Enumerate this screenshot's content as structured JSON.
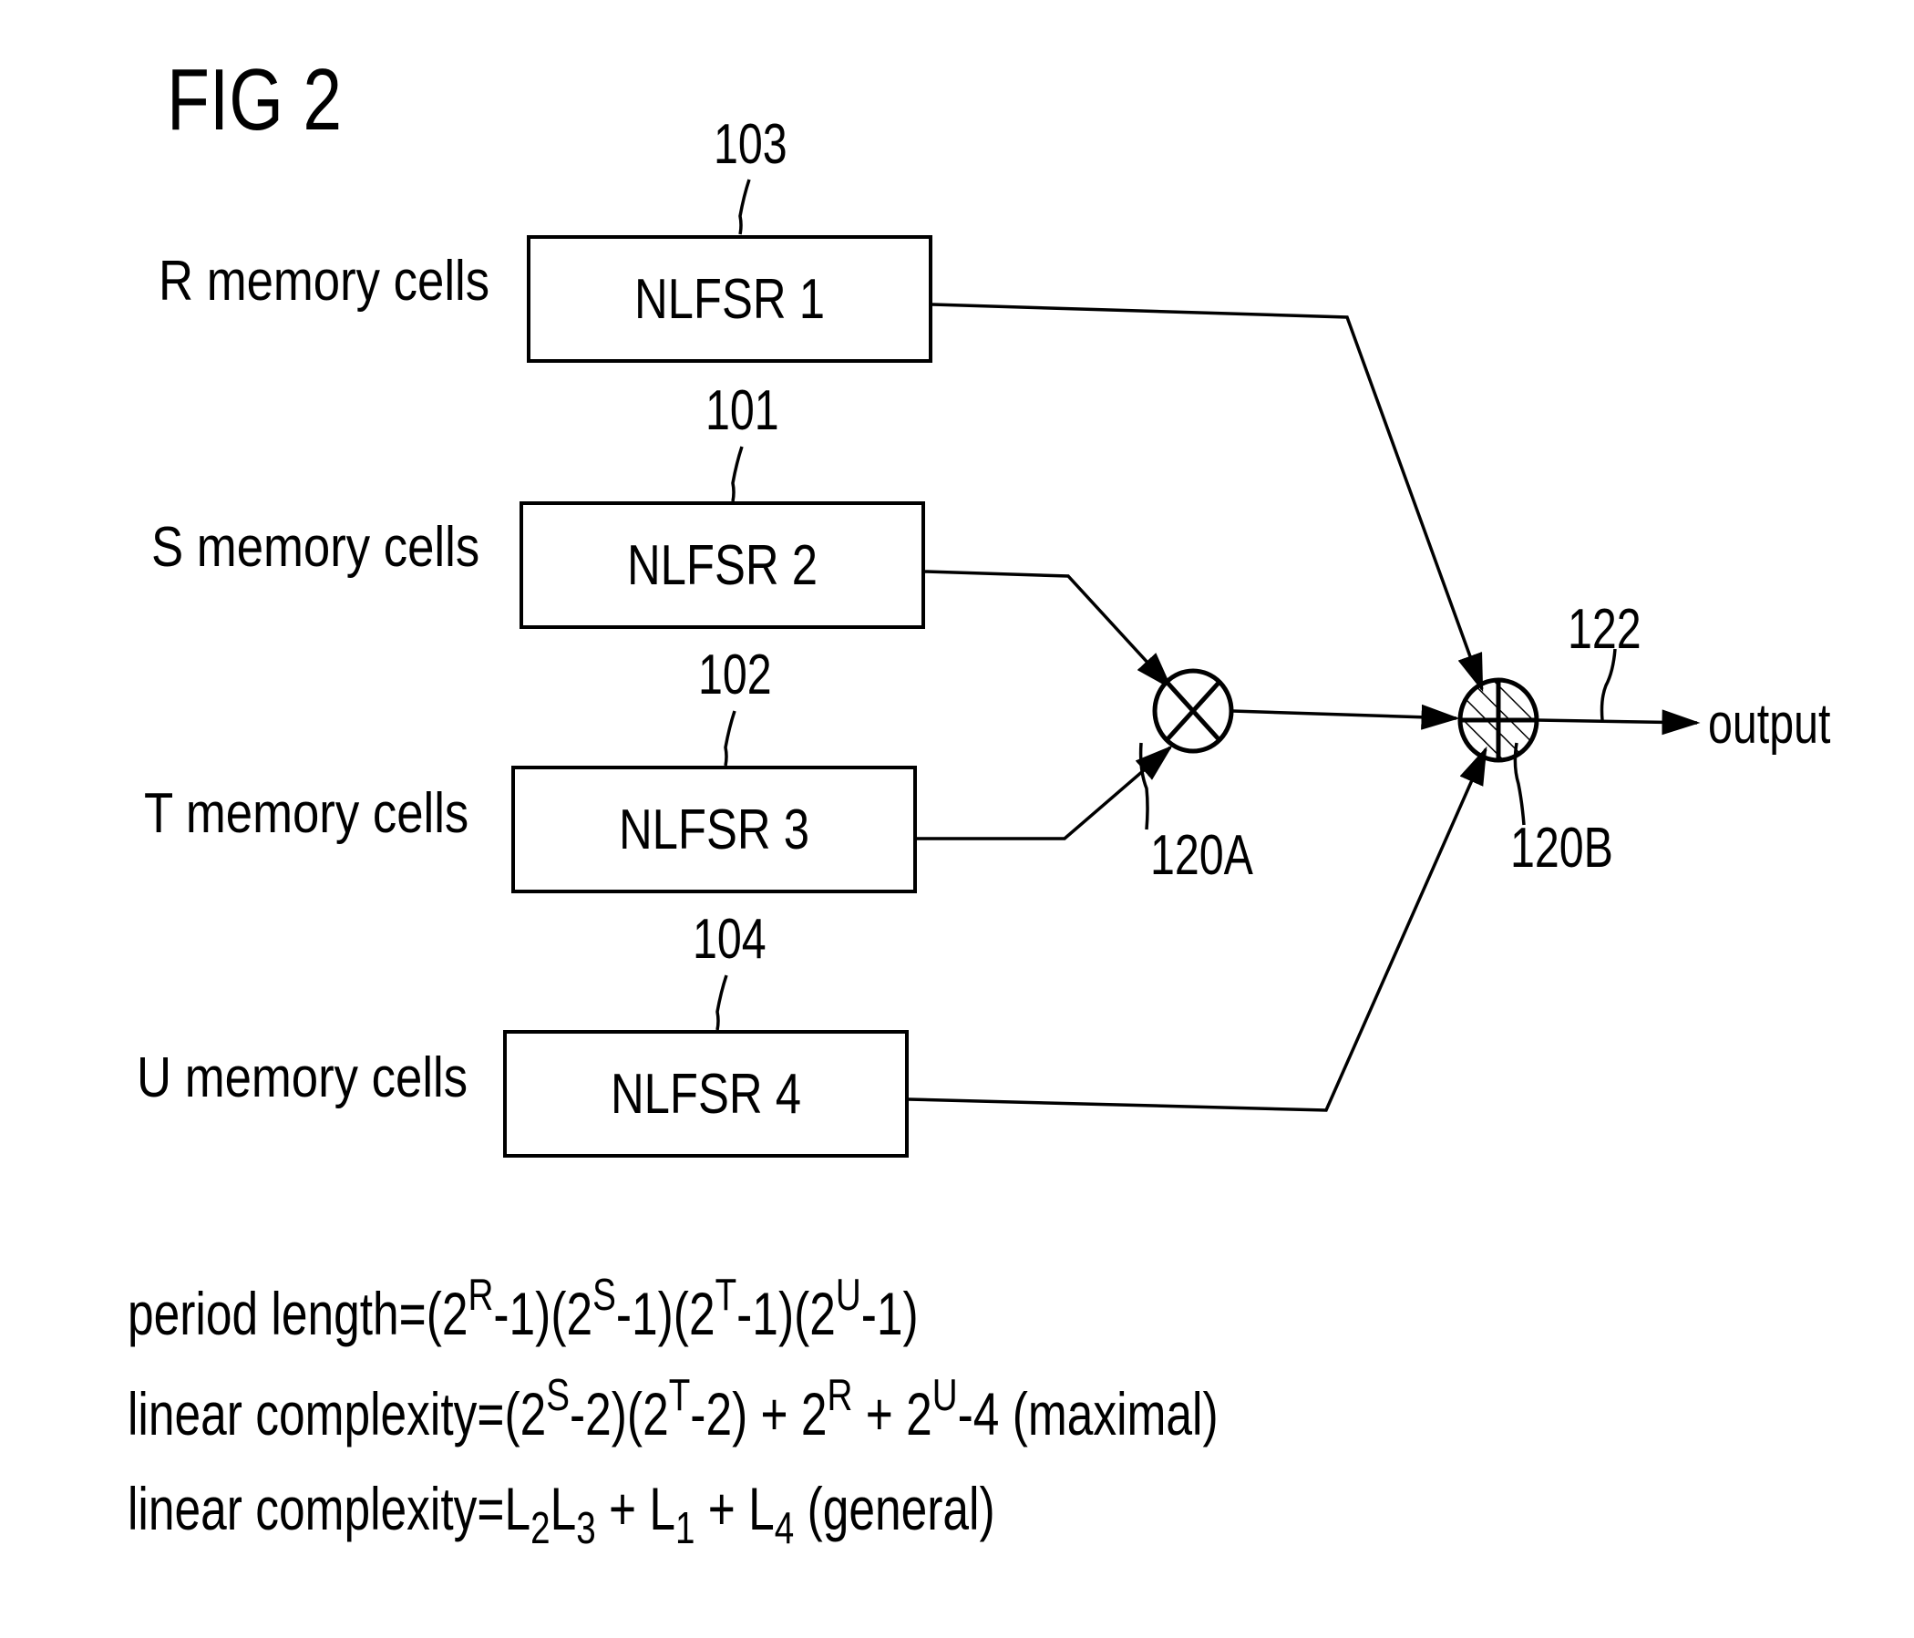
{
  "figure": {
    "title": "FIG 2"
  },
  "registers": [
    {
      "ref": "103",
      "label": "R memory cells",
      "name": "NLFSR 1"
    },
    {
      "ref": "101",
      "label": "S memory cells",
      "name": "NLFSR 2"
    },
    {
      "ref": "102",
      "label": "T memory cells",
      "name": "NLFSR 3"
    },
    {
      "ref": "104",
      "label": "U memory cells",
      "name": "NLFSR 4"
    }
  ],
  "combiners": {
    "multiplier": {
      "ref": "120A",
      "symbol": "AND / multiply"
    },
    "xor": {
      "ref": "120B",
      "symbol": "XOR / add"
    }
  },
  "output": {
    "ref": "122",
    "label": "output"
  },
  "equations": {
    "period": {
      "lhs": "period length",
      "eq": "=",
      "terms": [
        {
          "b": "(2",
          "e": "R",
          "t": "-1)"
        },
        {
          "b": "(2",
          "e": "S",
          "t": "-1)"
        },
        {
          "b": "(2",
          "e": "T",
          "t": "-1)"
        },
        {
          "b": "(2",
          "e": "U",
          "t": "-1)"
        }
      ]
    },
    "max": {
      "lhs": "linear complexity",
      "eq": "=",
      "p1b": "(2",
      "p1e": "S",
      "p1t": "-2)",
      "p2b": "(2",
      "p2e": "T",
      "p2t": "-2)",
      "plus1": " + 2",
      "p3e": "R",
      "plus2": " + 2",
      "p4e": "U",
      "tail": "-4",
      "note": " (maximal)"
    },
    "gen": {
      "lhs": "linear complexity",
      "eq": "=",
      "l": "L",
      "s2": "2",
      "s3": "3",
      "s1": "1",
      "s4": "4",
      "plus": " + ",
      "note": " (general)"
    }
  }
}
